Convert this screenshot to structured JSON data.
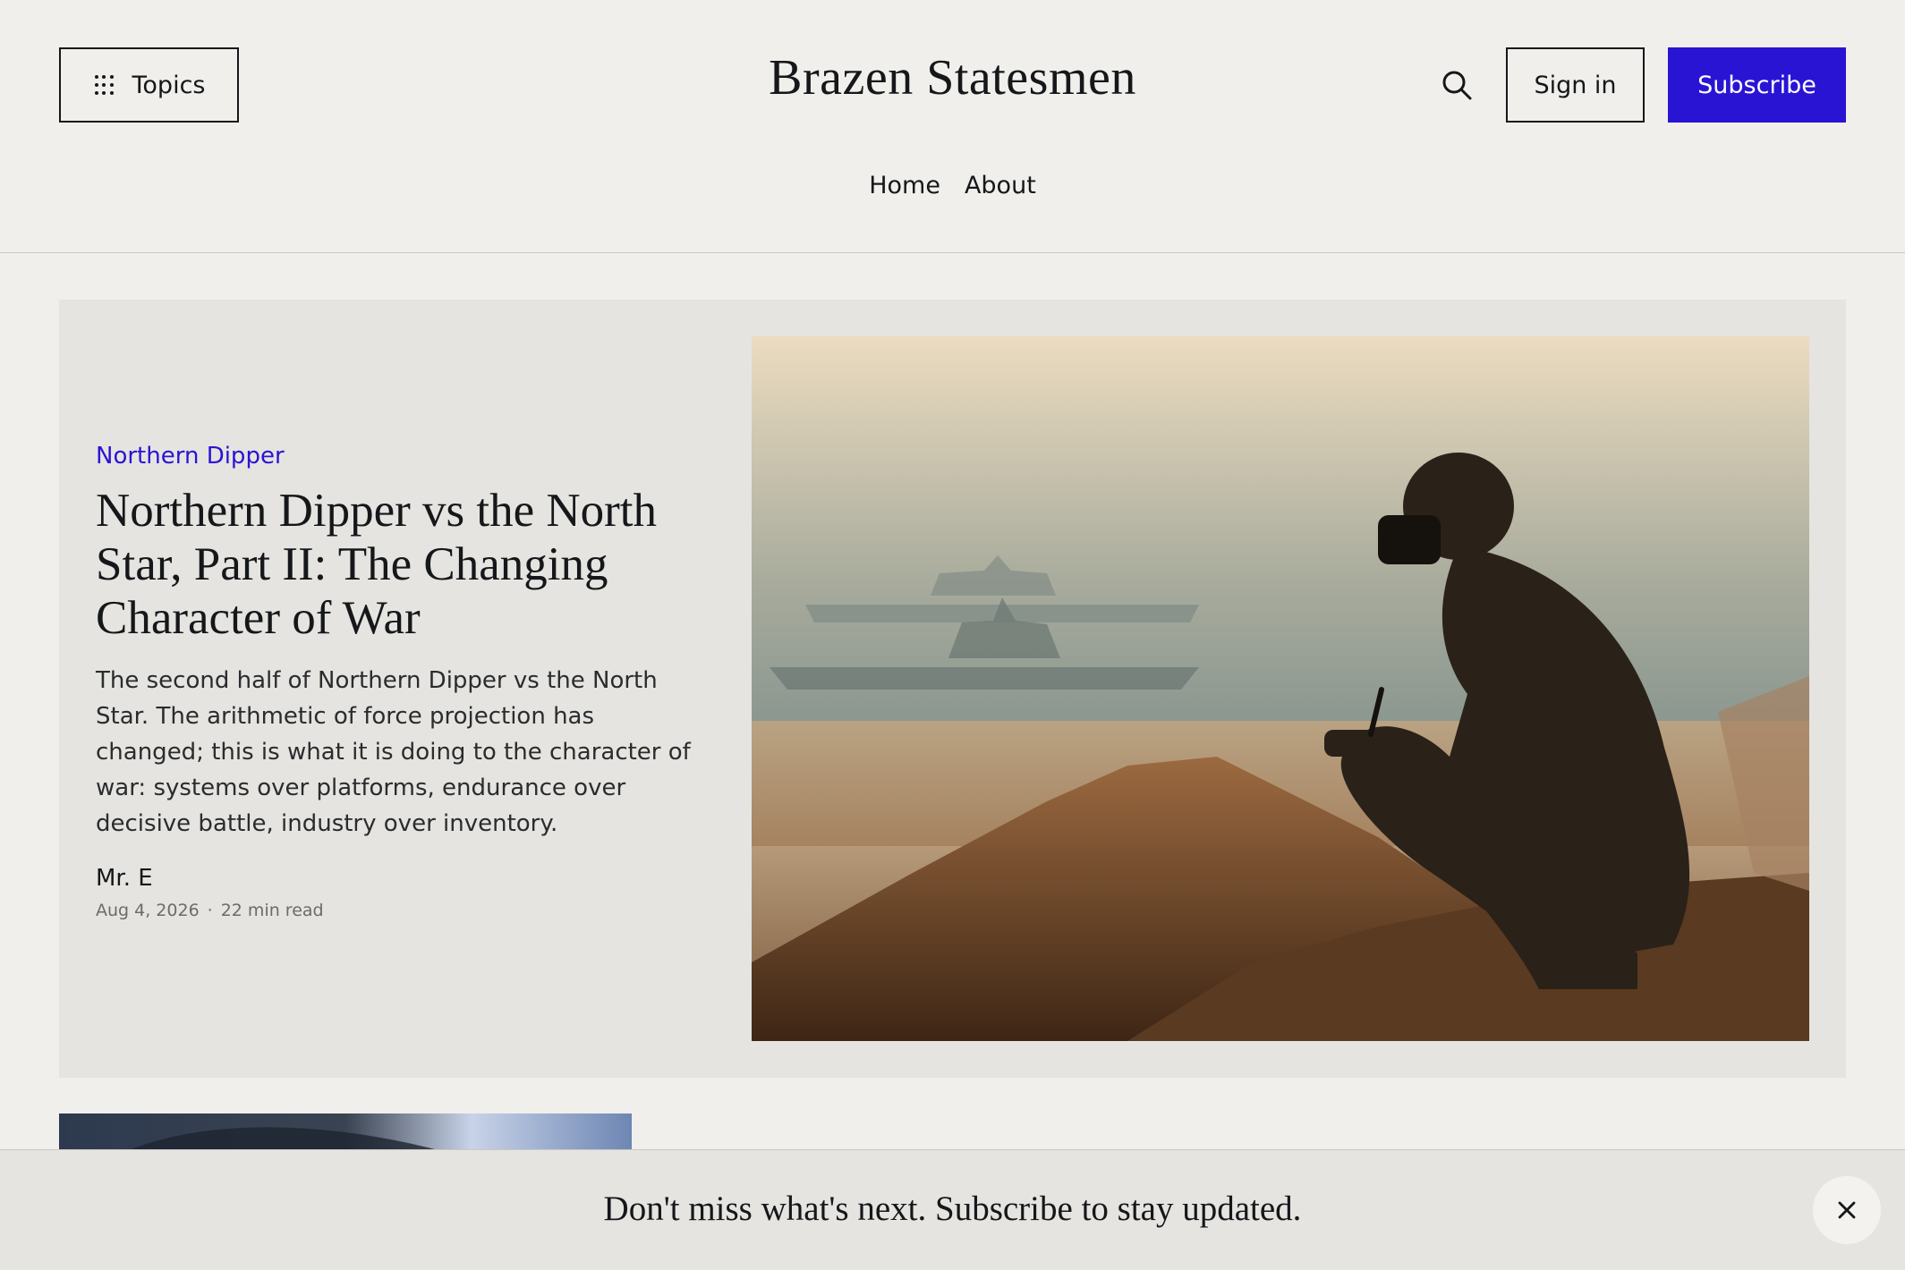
{
  "header": {
    "topics_label": "Topics",
    "site_title": "Brazen Statesmen",
    "signin_label": "Sign in",
    "subscribe_label": "Subscribe",
    "nav": [
      {
        "label": "Home"
      },
      {
        "label": "About"
      }
    ],
    "icons": {
      "topics": "grid-dots-icon",
      "search": "search-icon"
    }
  },
  "featured": {
    "tag": "Northern Dipper",
    "title": "Northern Dipper vs the North Star, Part II: The Changing Character of War",
    "excerpt": "The second half of Northern Dipper vs the North Star. The arithmetic of force projection has changed; this is what it is doing to the character of war: systems over platforms, endurance over decisive battle, industry over inventory.",
    "author": "Mr. E",
    "date": "Aug 4, 2026",
    "read_time": "22 min read"
  },
  "banner": {
    "text": "Don't miss what's next. Subscribe to stay updated.",
    "close_icon": "close-icon"
  },
  "colors": {
    "background": "#f0efeb",
    "card": "#e5e4e0",
    "accent": "#2a14d4",
    "text": "#15171a"
  }
}
